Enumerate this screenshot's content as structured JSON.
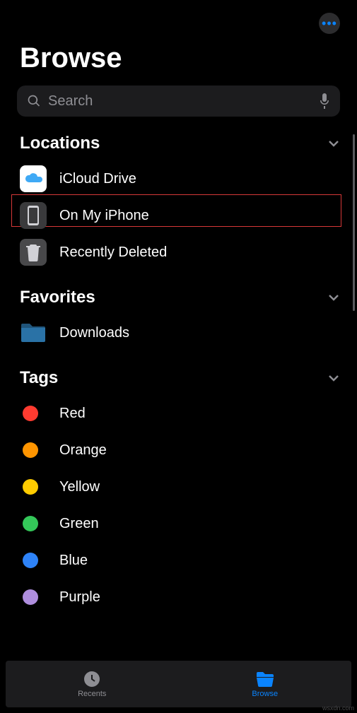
{
  "header": {
    "more_button": "•••",
    "title": "Browse"
  },
  "search": {
    "placeholder": "Search"
  },
  "sections": {
    "locations": {
      "title": "Locations",
      "items": [
        {
          "label": "iCloud Drive",
          "icon": "icloud-icon"
        },
        {
          "label": "On My iPhone",
          "icon": "phone-icon"
        },
        {
          "label": "Recently Deleted",
          "icon": "trash-icon"
        }
      ]
    },
    "favorites": {
      "title": "Favorites",
      "items": [
        {
          "label": "Downloads",
          "icon": "folder-icon"
        }
      ]
    },
    "tags": {
      "title": "Tags",
      "items": [
        {
          "label": "Red",
          "color": "#ff3b30"
        },
        {
          "label": "Orange",
          "color": "#ff9500"
        },
        {
          "label": "Yellow",
          "color": "#ffcc00"
        },
        {
          "label": "Green",
          "color": "#34c759"
        },
        {
          "label": "Blue",
          "color": "#007aff"
        },
        {
          "label": "Purple",
          "color": "#af52de"
        }
      ]
    }
  },
  "bottom_nav": {
    "recents": "Recents",
    "browse": "Browse"
  },
  "highlighted_item": "On My iPhone",
  "watermark": "wsxdn.com"
}
